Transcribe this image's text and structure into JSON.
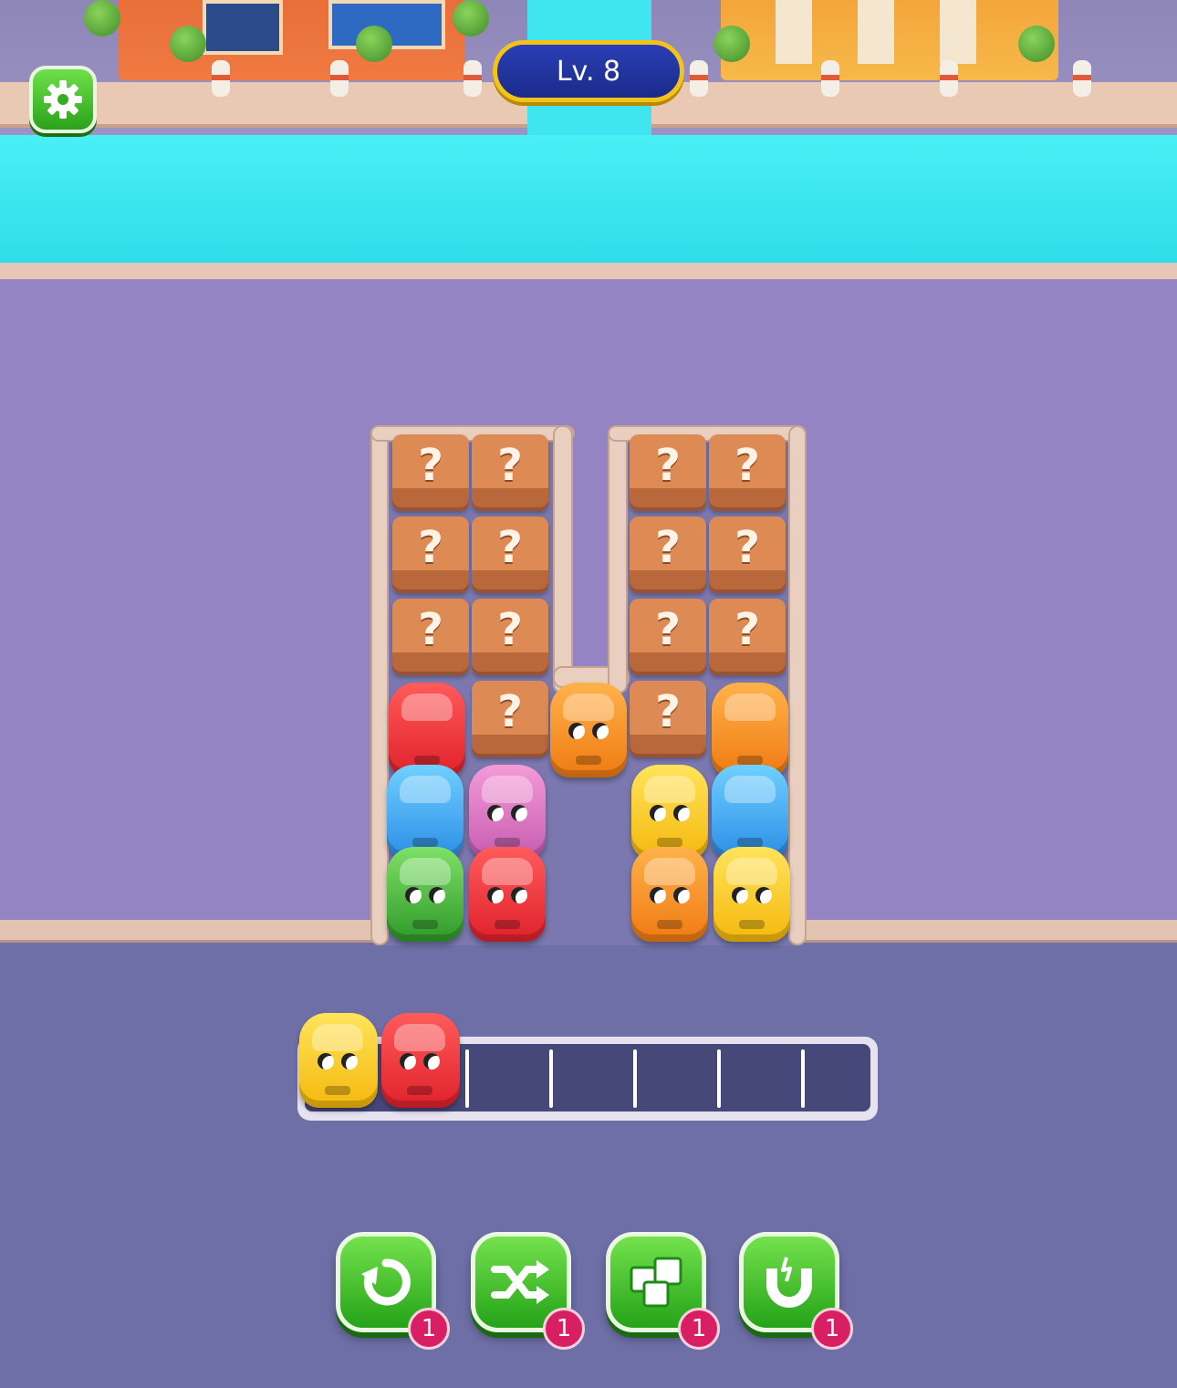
{
  "hud": {
    "level_label": "Lv. 8",
    "settings_icon": "gear-icon"
  },
  "board": {
    "crate_symbol": "?",
    "left_block": {
      "crate_rows": 3,
      "column_a": [
        "crate",
        "crate",
        "crate",
        "red"
      ],
      "column_b": [
        "crate",
        "crate",
        "crate",
        "crate"
      ]
    },
    "cars": {
      "left_lot": [
        [
          "red",
          "crate"
        ],
        [
          "blue",
          "pink"
        ],
        [
          "green",
          "red"
        ]
      ],
      "center": "orange",
      "right_lot": [
        [
          "crate",
          "orange"
        ],
        [
          "yellow",
          "blue"
        ],
        [
          "orange",
          "yellow"
        ]
      ]
    }
  },
  "queue": {
    "capacity": 7,
    "cars": [
      "yellow",
      "red"
    ]
  },
  "boosters": [
    {
      "name": "undo",
      "icon": "undo-icon",
      "count": "1"
    },
    {
      "name": "shuffle",
      "icon": "shuffle-icon",
      "count": "1"
    },
    {
      "name": "sort",
      "icon": "blocks-icon",
      "count": "1"
    },
    {
      "name": "magnet",
      "icon": "magnet-icon",
      "count": "1"
    }
  ]
}
